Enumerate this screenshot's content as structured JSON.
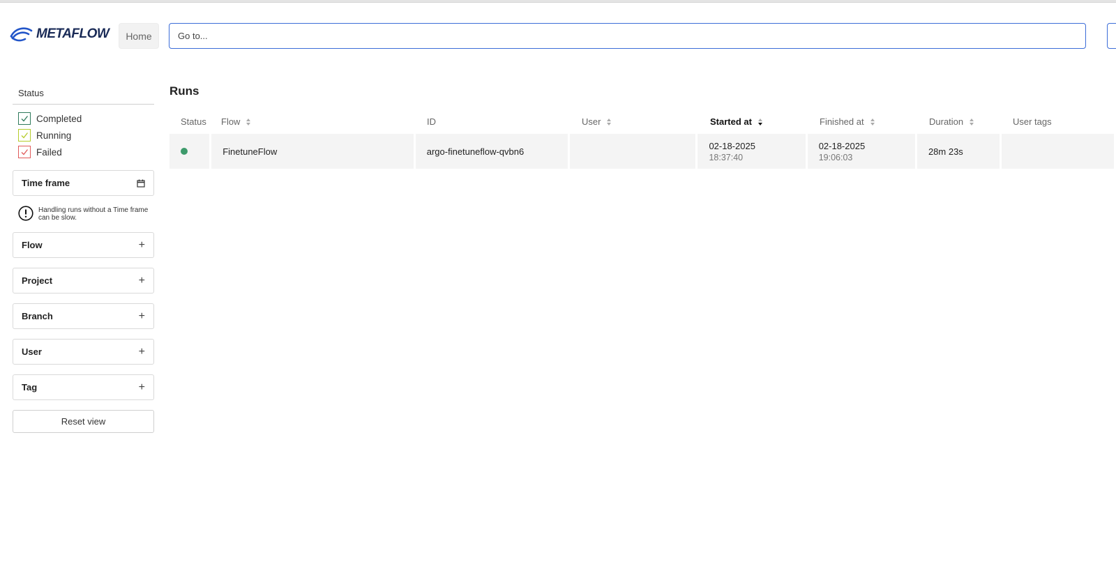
{
  "header": {
    "logo_text": "METAFLOW",
    "home_label": "Home",
    "search_placeholder": "Go to..."
  },
  "sidebar": {
    "status_title": "Status",
    "statuses": [
      {
        "label": "Completed",
        "color": "#2f7a5c"
      },
      {
        "label": "Running",
        "color": "#b5cc2b"
      },
      {
        "label": "Failed",
        "color": "#e05a5a"
      }
    ],
    "timeframe_label": "Time frame",
    "timeframe_warning": "Handling runs without a Time frame can be slow.",
    "filters": [
      {
        "label": "Flow"
      },
      {
        "label": "Project"
      },
      {
        "label": "Branch"
      },
      {
        "label": "User"
      },
      {
        "label": "Tag"
      }
    ],
    "reset_label": "Reset view"
  },
  "runs": {
    "title": "Runs",
    "columns": [
      "Status",
      "Flow",
      "ID",
      "User",
      "Started at",
      "Finished at",
      "Duration",
      "User tags"
    ],
    "active_sort_column": "Started at",
    "rows": [
      {
        "status_color": "#3d9a6b",
        "flow": "FinetuneFlow",
        "id": "argo-finetuneflow-qvbn6",
        "user": "",
        "started_date": "02-18-2025",
        "started_time": "18:37:40",
        "finished_date": "02-18-2025",
        "finished_time": "19:06:03",
        "duration": "28m 23s",
        "user_tags": ""
      }
    ]
  }
}
